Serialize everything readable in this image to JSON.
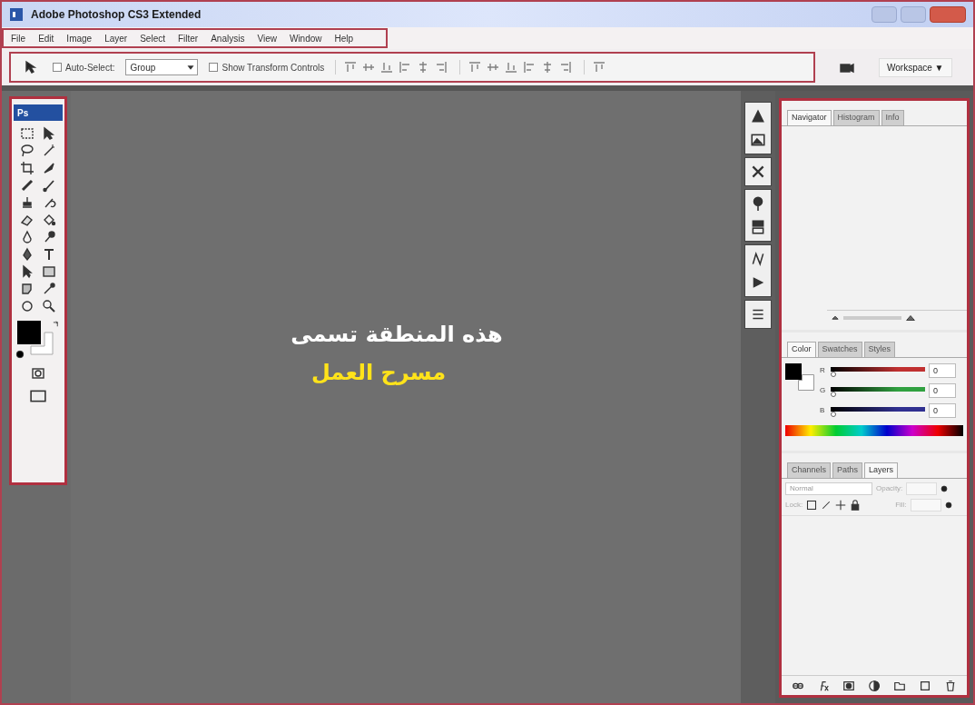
{
  "window": {
    "title": "Adobe Photoshop CS3 Extended"
  },
  "menu": [
    "File",
    "Edit",
    "Image",
    "Layer",
    "Select",
    "Filter",
    "Analysis",
    "View",
    "Window",
    "Help"
  ],
  "options_bar": {
    "auto_select": {
      "label": "Auto-Select:",
      "checked": false
    },
    "target": {
      "value": "Group"
    },
    "show_transform": {
      "label": "Show Transform Controls",
      "checked": false
    },
    "workspace": "Workspace ▼"
  },
  "toolbox": {
    "logo": "Ps"
  },
  "canvas": {
    "caption_line_1": "هذه المنطقة تسمى",
    "caption_line_2": "مسرح العمل"
  },
  "navigator_panel": {
    "tabs": [
      {
        "label": "Navigator",
        "selected": true
      },
      {
        "label": "Histogram",
        "selected": false
      },
      {
        "label": "Info",
        "selected": false
      }
    ]
  },
  "color_panel": {
    "tabs": [
      {
        "label": "Color",
        "selected": true
      },
      {
        "label": "Swatches",
        "selected": false
      },
      {
        "label": "Styles",
        "selected": false
      }
    ],
    "channels": [
      {
        "name": "R",
        "color": "#c03030",
        "level": 0,
        "reading": "0"
      },
      {
        "name": "G",
        "color": "#30a040",
        "level": 0,
        "reading": "0"
      },
      {
        "name": "B",
        "color": "#303090",
        "level": 0,
        "reading": "0"
      }
    ]
  },
  "layers_panel": {
    "tabs": [
      {
        "label": "Channels",
        "selected": false
      },
      {
        "label": "Paths",
        "selected": false
      },
      {
        "label": "Layers",
        "selected": true
      }
    ],
    "blend_mode": "Normal",
    "opacity_label": "Opacity:",
    "lock_label": "Lock:",
    "fill_label": "Fill:"
  }
}
